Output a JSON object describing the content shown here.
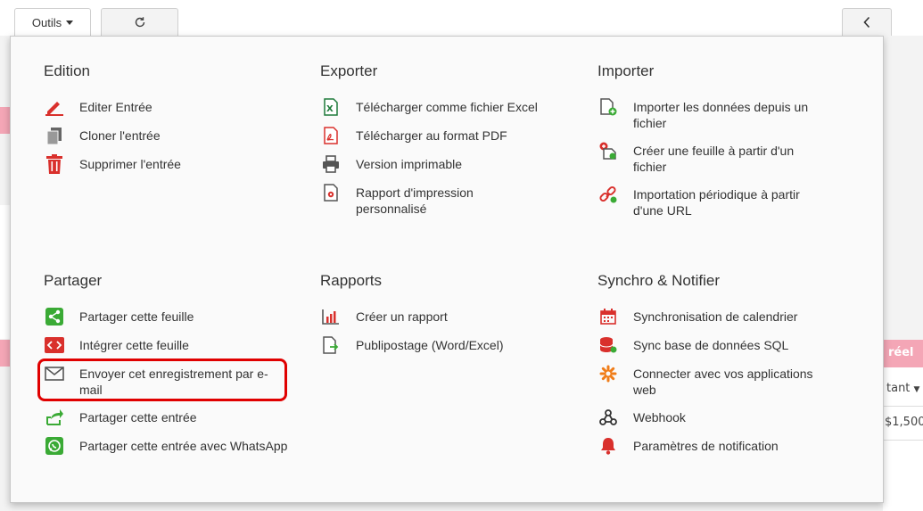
{
  "toolbar": {
    "tools_label": "Outils",
    "refresh_glyph": "↻",
    "back_glyph": "‹"
  },
  "background": {
    "right_header": "réel",
    "right_column": "tant",
    "right_value": "$1,500"
  },
  "sections": {
    "edition": {
      "title": "Edition",
      "items": [
        "Editer Entrée",
        "Cloner l'entrée",
        "Supprimer l'entrée"
      ]
    },
    "exporter": {
      "title": "Exporter",
      "items": [
        "Télécharger comme fichier Excel",
        "Télécharger au format PDF",
        "Version imprimable",
        "Rapport d'impression personnalisé"
      ]
    },
    "importer": {
      "title": "Importer",
      "items": [
        "Importer les données depuis un fichier",
        "Créer une feuille à partir d'un fichier",
        "Importation périodique à partir d'une URL"
      ]
    },
    "partager": {
      "title": "Partager",
      "items": [
        "Partager cette feuille",
        "Intégrer cette feuille",
        "Envoyer cet enregistrement par e-mail",
        "Partager cette entrée",
        "Partager cette entrée avec WhatsApp"
      ]
    },
    "rapports": {
      "title": "Rapports",
      "items": [
        "Créer un rapport",
        "Publipostage (Word/Excel)"
      ]
    },
    "synchro": {
      "title": "Synchro & Notifier",
      "items": [
        "Synchronisation de calendrier",
        "Sync base de données SQL",
        "Connecter avec vos applications web",
        "Webhook",
        "Paramètres de notification"
      ]
    }
  },
  "colors": {
    "red": "#d9302c",
    "green": "#3aaa35",
    "orange": "#f07d19",
    "gray": "#555555",
    "highlight": "#e00000"
  }
}
